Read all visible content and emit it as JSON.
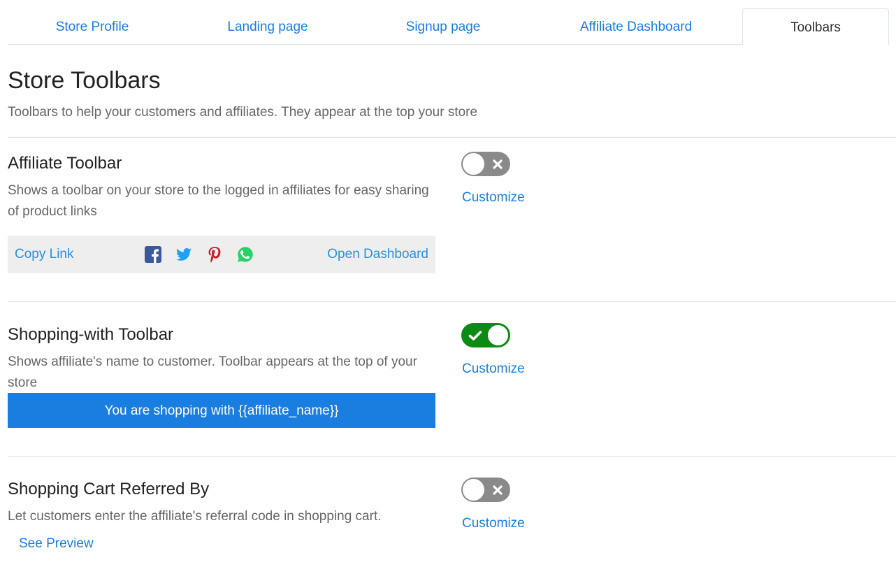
{
  "tabs": [
    {
      "label": "Store Profile"
    },
    {
      "label": "Landing page"
    },
    {
      "label": "Signup page"
    },
    {
      "label": "Affiliate Dashboard"
    },
    {
      "label": "Toolbars",
      "active": true
    }
  ],
  "page": {
    "title": "Store Toolbars",
    "subtitle": "Toolbars to help your customers and affiliates. They appear at the top your store"
  },
  "sections": {
    "affiliate": {
      "title": "Affiliate Toolbar",
      "description": "Shows a toolbar on your store to the logged in affiliates for easy sharing of product links",
      "enabled": false,
      "customize_label": "Customize",
      "preview": {
        "copy_label": "Copy Link",
        "open_label": "Open Dashboard",
        "icons": [
          "facebook-icon",
          "twitter-icon",
          "pinterest-icon",
          "whatsapp-icon"
        ]
      }
    },
    "shopping_with": {
      "title": "Shopping-with Toolbar",
      "description": "Shows affiliate's name to customer. Toolbar appears at the top of your store",
      "enabled": true,
      "customize_label": "Customize",
      "preview_text": "You are shopping with {{affiliate_name}}"
    },
    "cart_referred": {
      "title": "Shopping Cart Referred By",
      "description": "Let customers enter the affiliate's referral code in shopping cart.",
      "enabled": false,
      "customize_label": "Customize",
      "see_preview_label": "See Preview"
    }
  },
  "colors": {
    "link": "#1a7de0",
    "toggle_on": "#0d8a14",
    "toggle_off": "#8a8a8a",
    "facebook": "#3b5998",
    "twitter": "#1da1f2",
    "pinterest": "#cb2027",
    "whatsapp": "#25d366"
  }
}
